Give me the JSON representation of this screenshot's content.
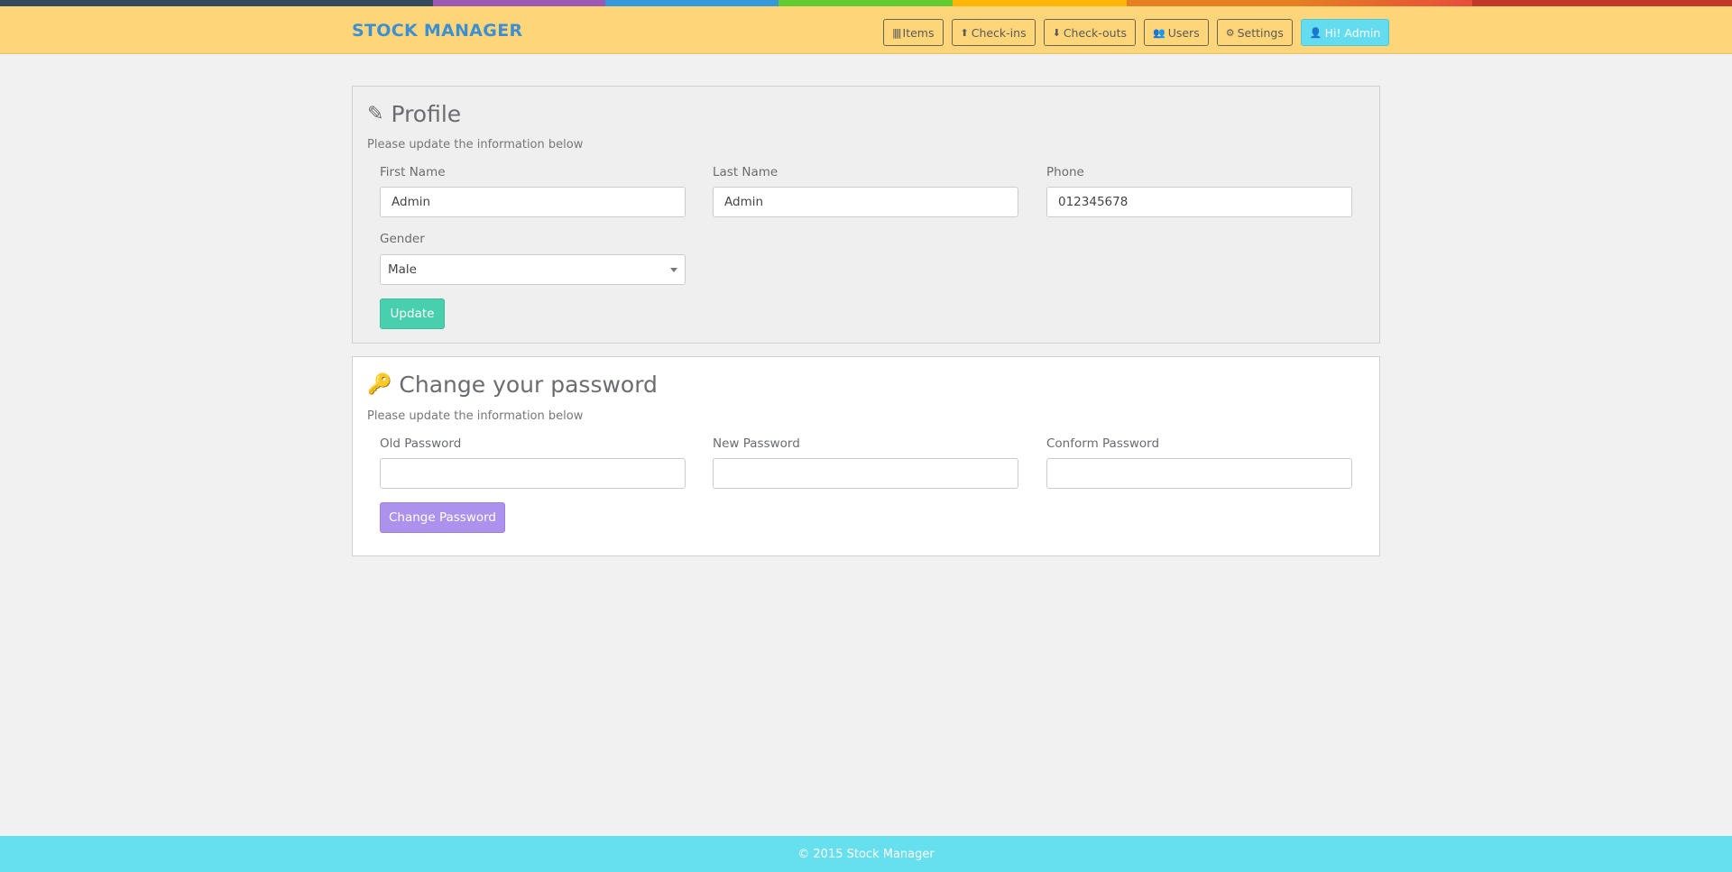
{
  "colors": {
    "stripe": [
      "#34495e",
      "#9b59b6",
      "#3498db",
      "#62cb31",
      "#ffb606",
      "#e67e22",
      "#c0392b"
    ],
    "header_bg": "#ffd57a",
    "brand": "#3e8fd0",
    "update_button": "#48cfad",
    "change_password_button": "#ac92ec",
    "footer": "#66dfef"
  },
  "header": {
    "brand": "STOCK MANAGER",
    "nav": [
      {
        "label": "Items",
        "icon": "barcode-icon"
      },
      {
        "label": "Check-ins",
        "icon": "arrow-circle-up-icon"
      },
      {
        "label": "Check-outs",
        "icon": "arrow-circle-down-icon"
      },
      {
        "label": "Users",
        "icon": "users-icon"
      },
      {
        "label": "Settings",
        "icon": "cogs-icon"
      },
      {
        "label": "Hi! Admin",
        "icon": "user-icon"
      }
    ]
  },
  "profile": {
    "title": "Profile",
    "icon": "edit-icon",
    "subtitle": "Please update the information below",
    "first_name_label": "First Name",
    "first_name": "Admin",
    "last_name_label": "Last Name",
    "last_name": "Admin",
    "phone_label": "Phone",
    "phone": "012345678",
    "gender_label": "Gender",
    "gender": "Male",
    "update": "Update"
  },
  "password": {
    "title": "Change your password",
    "icon": "key-icon",
    "subtitle": "Please update the information below",
    "old_label": "Old Password",
    "old": "",
    "new_label": "New Password",
    "new": "",
    "confirm_label": "Conform Password",
    "confirm": "",
    "button": "Change Password"
  },
  "footer": {
    "text": "© 2015 Stock Manager"
  }
}
